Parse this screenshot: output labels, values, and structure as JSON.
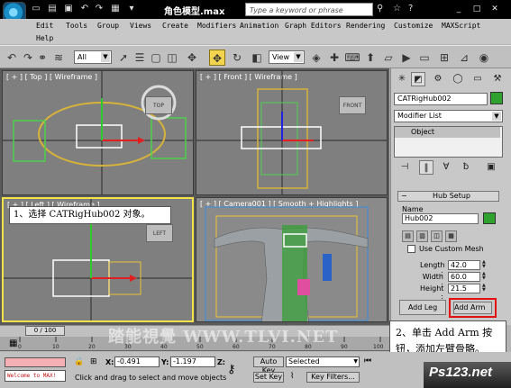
{
  "titlebar": {
    "title": "角色模型.max",
    "search_placeholder": "Type a keyword or phrase",
    "window_controls": [
      "_",
      "□",
      "✕"
    ]
  },
  "menu": {
    "row1": [
      "Edit",
      "Tools",
      "Group",
      "Views",
      "Create",
      "Modifiers",
      "Animation",
      "Graph Editors",
      "Rendering",
      "Customize",
      "MAXScript"
    ],
    "row2": [
      "Help"
    ]
  },
  "toolbar": {
    "selection_filter": "All",
    "ref_coord": "View"
  },
  "viewports": {
    "top": "[ + ] [ Top ] [ Wireframe ]",
    "front": "[ + ] [ Front ] [ Wireframe ]",
    "left": "[ + ] [ Left ] [ Wireframe ]",
    "camera": "[ + ] [ Camera001 ] [ Smooth + Highlights ]",
    "gizmo_top": "TOP",
    "gizmo_front": "FRONT",
    "gizmo_left": "LEFT"
  },
  "panel": {
    "object_name": "CATRigHub002",
    "modifier_list": "Modifier List",
    "stack_item": "Object",
    "rollout_title": "Hub Setup",
    "name_label": "Name",
    "name_value": "Hub002",
    "custom_mesh_label": "Use Custom Mesh",
    "length_label": "Length :",
    "length_value": "42.0",
    "width_label": "Width :",
    "width_value": "60.0",
    "height_label": "Height :",
    "height_value": "21.5",
    "add_leg": "Add Leg",
    "add_arm": "Add Arm"
  },
  "callouts": {
    "step1": "1、选择 CATRigHub002 对象。",
    "step2_line1": "2、单击 Add Arm 按",
    "step2_line2": "钮，添加左臂骨骼。"
  },
  "timeline": {
    "frame": "0 / 100",
    "ticks": [
      "0",
      "10",
      "20",
      "30",
      "40",
      "50",
      "60",
      "70",
      "80",
      "90",
      "100"
    ]
  },
  "status": {
    "maxscript": "Welcome to MAX!",
    "x_label": "X:",
    "x_value": "-0.491",
    "y_label": "Y:",
    "y_value": "-1.197",
    "z_label": "Z:",
    "message": "Click and drag to select and move objects",
    "auto_key": "Auto Key",
    "set_key": "Set Key",
    "selected": "Selected",
    "key_filters": "Key Filters...",
    "watermark": "踏能視覺 WWW.TLVI.NET",
    "brand": "Ps123.net"
  },
  "colors": {
    "active_border": "#f2e34a",
    "callout_highlight": "#e21010",
    "object_color": "#2fa12f"
  }
}
